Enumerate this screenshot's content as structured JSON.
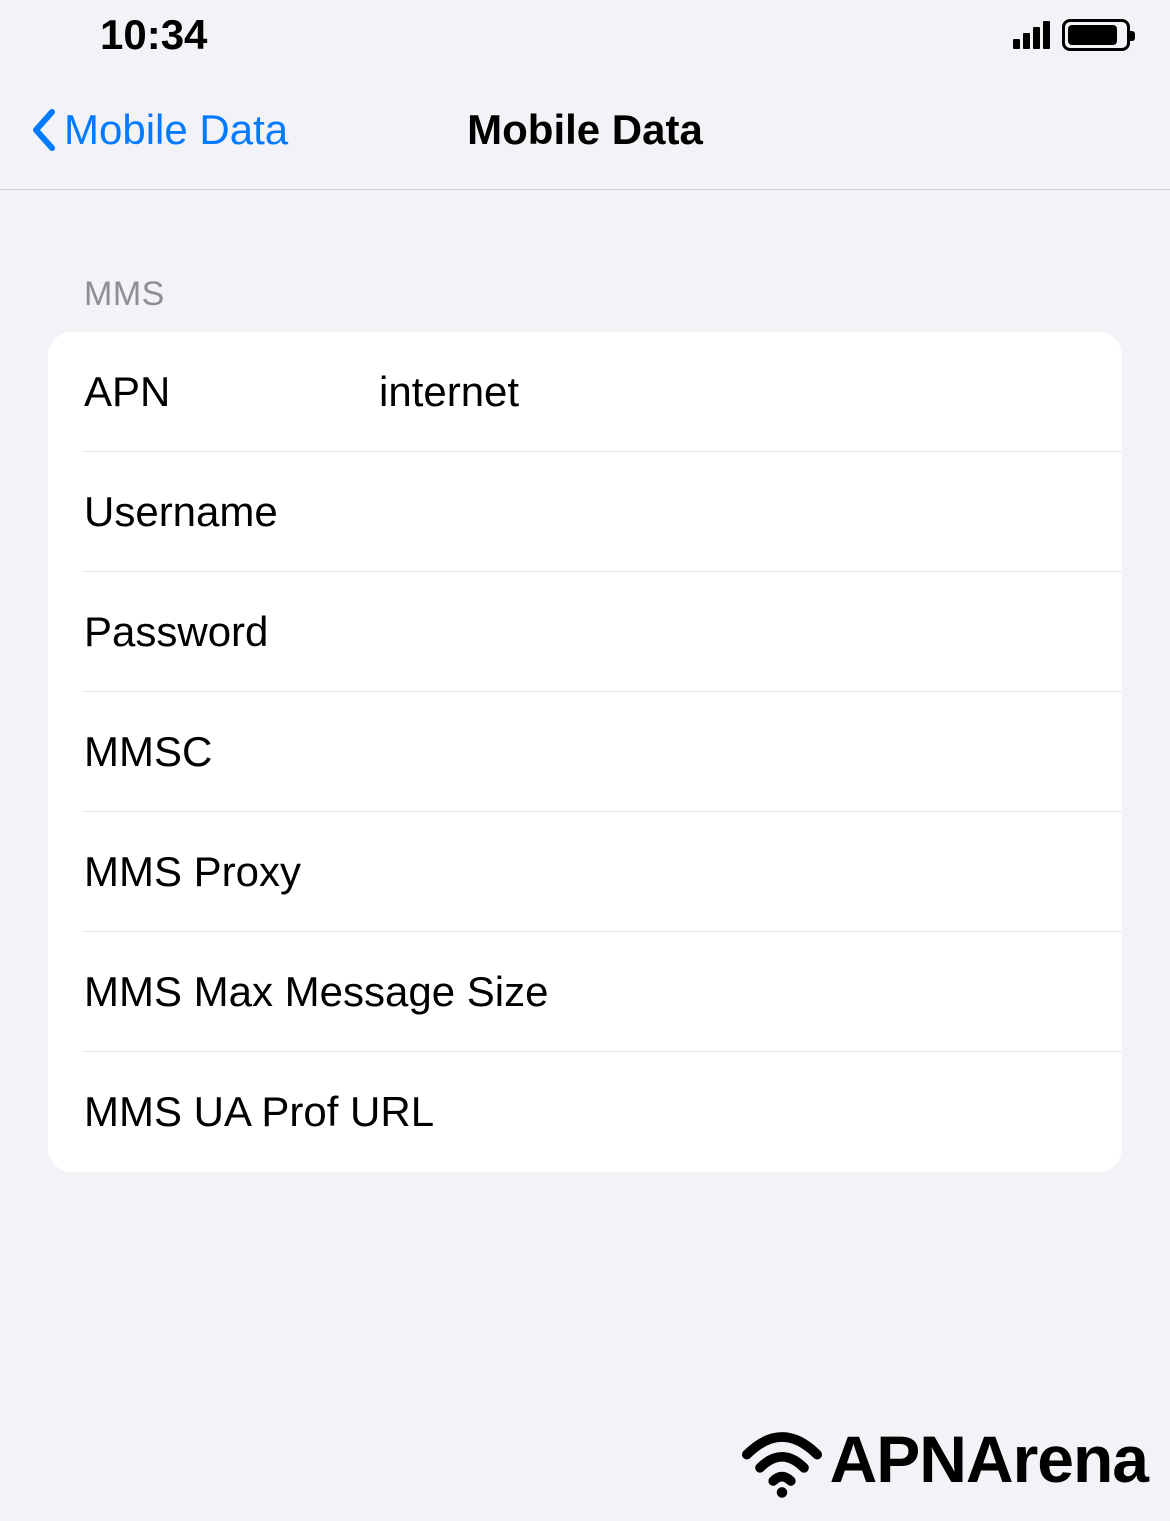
{
  "status_bar": {
    "time": "10:34"
  },
  "nav": {
    "back_label": "Mobile Data",
    "title": "Mobile Data"
  },
  "sections": {
    "mms": {
      "header": "MMS",
      "fields": {
        "apn": {
          "label": "APN",
          "value": "internet"
        },
        "username": {
          "label": "Username",
          "value": ""
        },
        "password": {
          "label": "Password",
          "value": ""
        },
        "mmsc": {
          "label": "MMSC",
          "value": ""
        },
        "mms_proxy": {
          "label": "MMS Proxy",
          "value": ""
        },
        "mms_max_message_size": {
          "label": "MMS Max Message Size",
          "value": ""
        },
        "mms_ua_prof_url": {
          "label": "MMS UA Prof URL",
          "value": ""
        }
      }
    }
  },
  "brand": {
    "name": "APNArena"
  }
}
